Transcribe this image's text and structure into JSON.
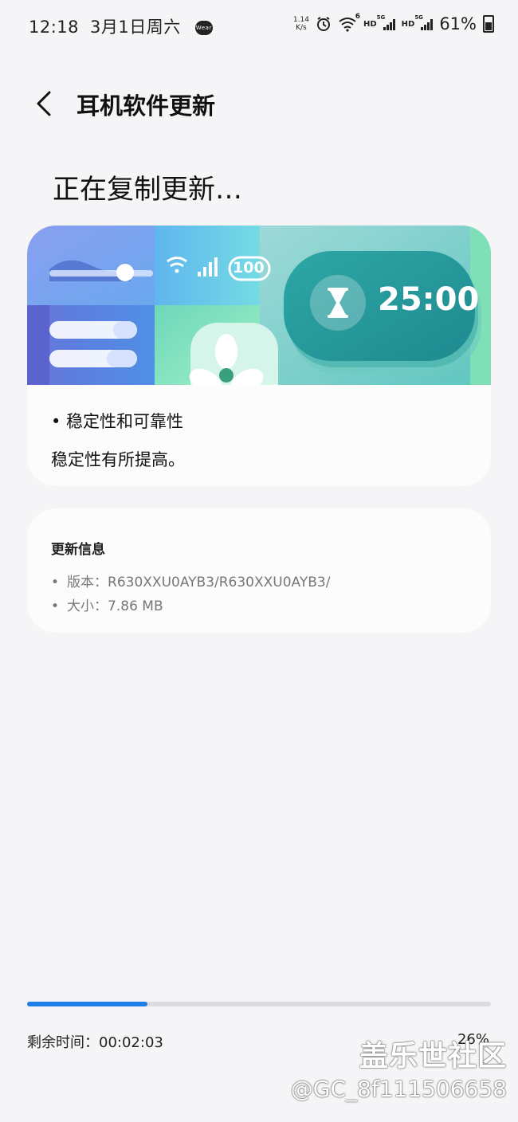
{
  "status_bar": {
    "time": "12:18",
    "date": "3月1日周六",
    "wear_badge": "Wear",
    "net_speed_value": "1.14",
    "net_speed_unit": "K/s",
    "wifi_gen": "6",
    "hd1": "HD",
    "sig1_tag": "5G",
    "hd2": "HD",
    "sig2_tag": "5G",
    "battery": "61%"
  },
  "header": {
    "title": "耳机软件更新"
  },
  "main": {
    "heading": "正在复制更新…",
    "banner": {
      "timer": "25:00",
      "battery_label": "100"
    },
    "feature_bullet": "•  稳定性和可靠性",
    "feature_desc": "稳定性有所提高。"
  },
  "update_info": {
    "title": "更新信息",
    "version_label": "版本：",
    "version_value": "R630XXU0AYB3/R630XXU0AYB3/",
    "size_label": "大小：",
    "size_value": "7.86 MB"
  },
  "progress": {
    "percent_value": 26,
    "remaining_label": "剩余时间：",
    "remaining_value": "00:02:03",
    "percent_text": "26%"
  },
  "watermark": {
    "site": "盖乐世社区",
    "user": "@GC_8f111506658"
  },
  "colors": {
    "accent": "#1f7fe8",
    "background": "#f5f5f7",
    "card": "#fcfcfd"
  }
}
